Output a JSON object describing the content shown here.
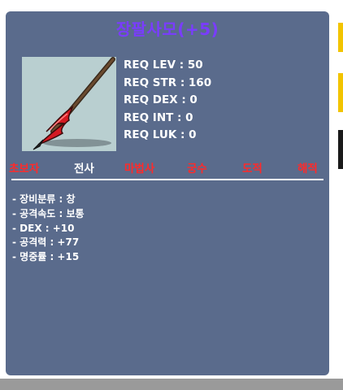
{
  "item": {
    "name": "장팔사모(+5)",
    "icon": "spear-icon"
  },
  "requirements": [
    "REQ LEV : 50",
    "REQ STR : 160",
    "REQ DEX : 0",
    "REQ INT : 0",
    "REQ LUK : 0"
  ],
  "jobs": [
    {
      "label": "초보자",
      "status": "unavailable"
    },
    {
      "label": "전사",
      "status": "available"
    },
    {
      "label": "마법사",
      "status": "unavailable"
    },
    {
      "label": "궁수",
      "status": "unavailable"
    },
    {
      "label": "도적",
      "status": "unavailable"
    },
    {
      "label": "해적",
      "status": "unavailable"
    }
  ],
  "stats": [
    "- 장비분류 : 창",
    "- 공격속도 : 보통",
    "- DEX : +10",
    "- 공격력 : +77",
    "- 명중률 : +15"
  ],
  "colors": {
    "panel": "#5a6b8c",
    "title": "#7a3cff",
    "job_unavailable": "#ff2a2a",
    "job_available": "#ffffff",
    "icon_background": "#b9cfd0"
  }
}
